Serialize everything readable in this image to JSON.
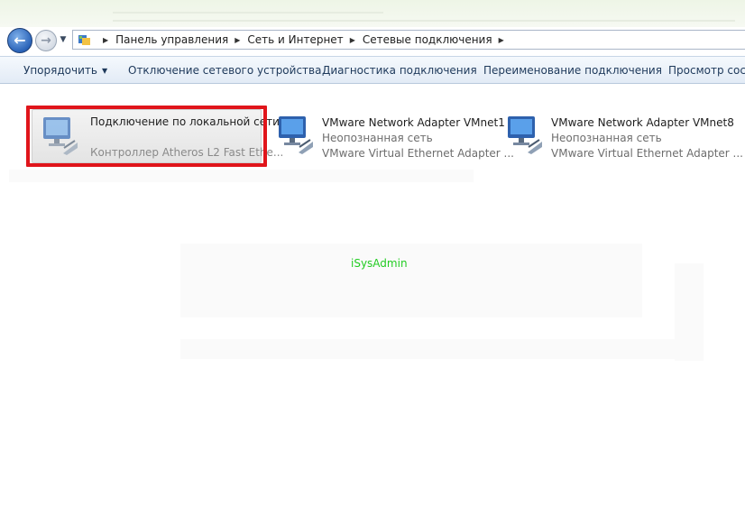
{
  "address": {
    "crumbs": [
      "Панель управления",
      "Сеть и Интернет",
      "Сетевые подключения"
    ]
  },
  "toolbar": {
    "organize": "Упорядочить",
    "disable": "Отключение сетевого устройства",
    "diagnose": "Диагностика подключения",
    "rename": "Переименование подключения",
    "view_status": "Просмотр сост"
  },
  "adapters": [
    {
      "name": "Подключение по локальной сети",
      "status": "",
      "device": "Контроллер Atheros L2 Fast Ethe...",
      "selected": true
    },
    {
      "name": "VMware Network Adapter VMnet1",
      "status": "Неопознанная сеть",
      "device": "VMware Virtual Ethernet Adapter ..."
    },
    {
      "name": "VMware Network Adapter VMnet8",
      "status": "Неопознанная сеть",
      "device": "VMware Virtual Ethernet Adapter ..."
    }
  ],
  "watermark": "iSysAdmin",
  "colors": {
    "highlight": "#e0151b",
    "watermark": "#22cc22",
    "toolbar_text": "#1e395b"
  },
  "icons": {
    "back": "back-arrow-icon",
    "forward": "forward-arrow-icon",
    "adapter": "network-adapter-icon"
  }
}
